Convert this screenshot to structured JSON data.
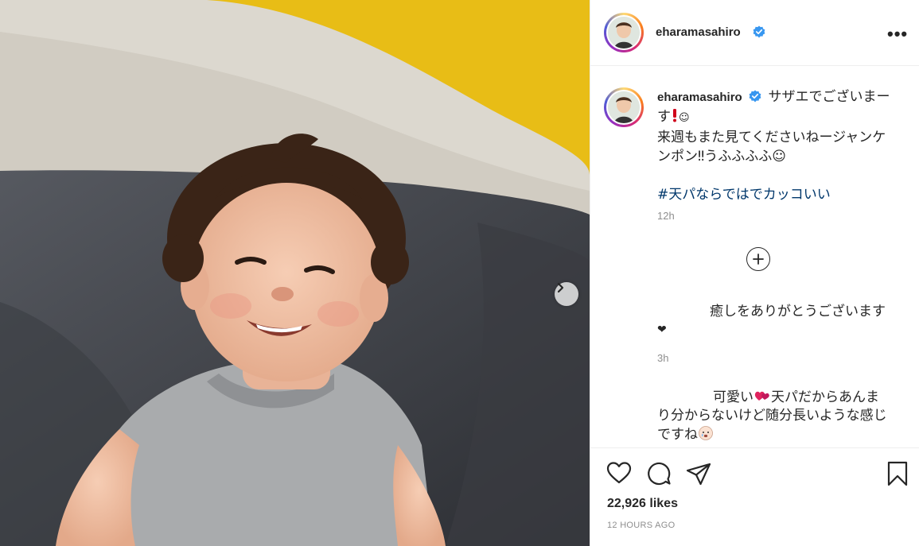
{
  "post": {
    "username": "eharamasahiro",
    "verified": true,
    "more_label": "•••",
    "caption_line1": "サザエでございまー",
    "caption_line2": "す",
    "caption_line3": "来週もまた見てくださいねージャンケ",
    "caption_line4": "ンポン‼︎うふふふふ☺︎",
    "hashtag": "#天パならではでカッコいい",
    "caption_time": "12h",
    "likes": "22,926 likes",
    "posted_ago": "12 HOURS AGO"
  },
  "comments": [
    {
      "line1": "癒しをありがとうございます",
      "line2": "❤",
      "time": "3h"
    },
    {
      "line1": "可愛い",
      "line1b": "天パだからあんま",
      "line2": "り分からないけど随分長いような感じ",
      "line3": "ですね"
    }
  ],
  "icons": {
    "verified": "verified-badge-icon",
    "more": "more-options-icon",
    "load_more": "plus-circle-icon",
    "like": "heart-icon",
    "comment": "comment-icon",
    "share": "paper-plane-icon",
    "save": "bookmark-icon",
    "next": "chevron-right-icon"
  },
  "colors": {
    "verified_blue": "#3897f0",
    "hashtag": "#00376b",
    "muted": "#8e8e8e",
    "background_wall": "#e8bd16"
  }
}
